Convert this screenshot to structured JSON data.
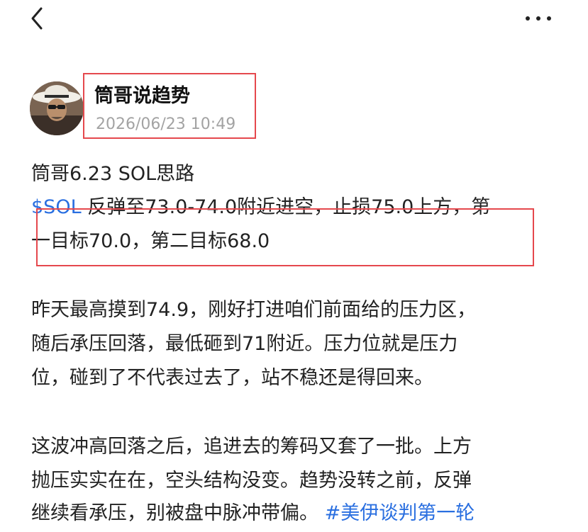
{
  "nav": {
    "back_icon": "chevron-left-icon",
    "more_icon": "more-horizontal-icon"
  },
  "author": {
    "name": "筒哥说趋势",
    "timestamp": "2026/06/23 10:49",
    "avatar_icon": "avatar-photo"
  },
  "post": {
    "title_line": "筒哥6.23 SOL思路",
    "ticker": "$SOL",
    "plan_line_1_rest": " 反弹至73.0-74.0附近进空，止损75.0上方，第",
    "plan_line_2": "一目标70.0，第二目标68.0",
    "paragraph_1": [
      "昨天最高摸到74.9，刚好打进咱们前面给的压力区，",
      "随后承压回落，最低砸到71附近。压力位就是压力",
      "位，碰到了不代表过去了，站不稳还是得回来。"
    ],
    "paragraph_2": [
      "这波冲高回落之后，追进去的筹码又套了一批。上方",
      "抛压实实在在，空头结构没变。趋势没转之前，反弹"
    ],
    "paragraph_2_last_text": "继续看承压，别被盘中脉冲带偏。",
    "hashtag": "#美伊谈判第一轮"
  },
  "colors": {
    "link": "#2a6fe0",
    "annotation_box": "#e5484d",
    "timestamp": "#a3a3a3"
  }
}
